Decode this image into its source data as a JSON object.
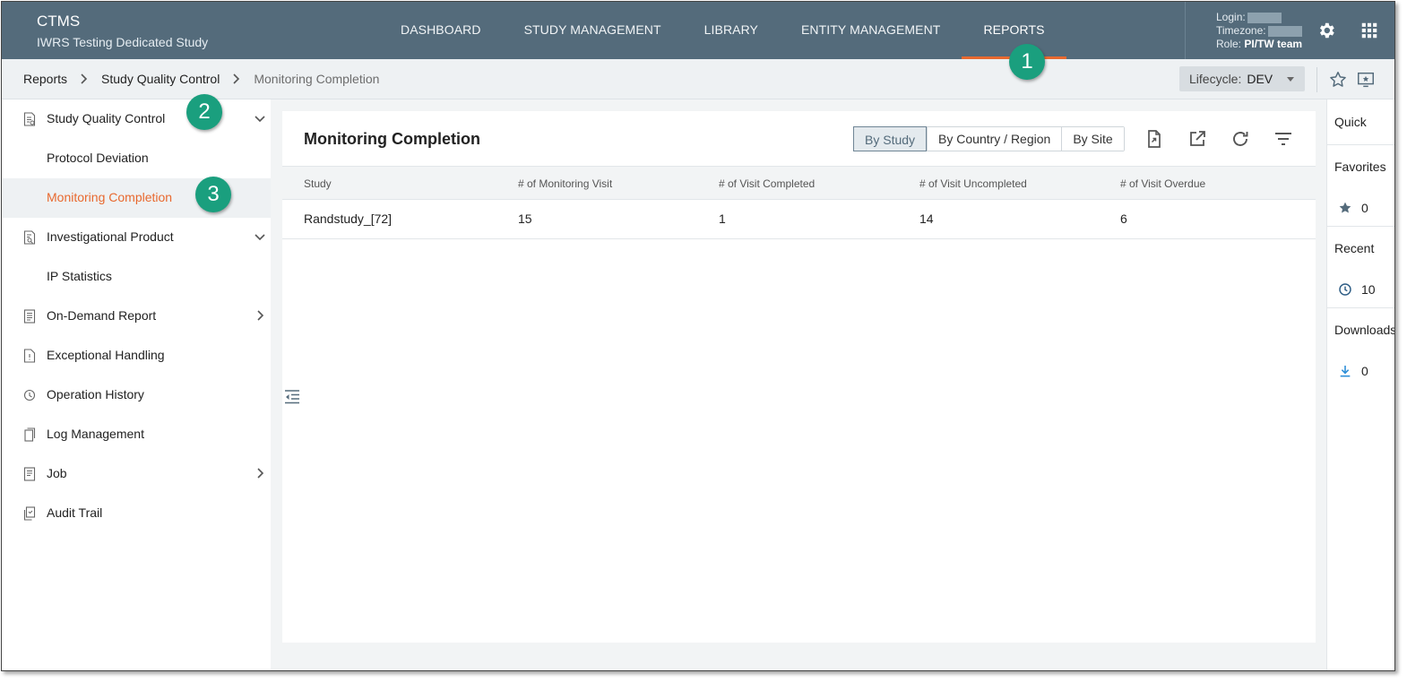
{
  "header": {
    "app_name": "CTMS",
    "study_name": "IWRS Testing Dedicated Study",
    "nav": [
      {
        "label": "DASHBOARD"
      },
      {
        "label": "STUDY MANAGEMENT"
      },
      {
        "label": "LIBRARY"
      },
      {
        "label": "ENTITY MANAGEMENT"
      },
      {
        "label": "REPORTS",
        "active": true
      }
    ],
    "user": {
      "login_label": "Login:",
      "timezone_label": "Timezone:",
      "role_label": "Role:",
      "role_value": "PI/TW team"
    },
    "icons": [
      "gear-icon",
      "apps-grid-icon"
    ]
  },
  "breadcrumb": {
    "items": [
      "Reports",
      "Study Quality Control",
      "Monitoring Completion"
    ],
    "lifecycle_label": "Lifecycle:",
    "lifecycle_value": "DEV"
  },
  "sidebar": {
    "items": [
      {
        "label": "Study Quality Control",
        "icon": "report-check-icon",
        "chevron": "down"
      },
      {
        "label": "Protocol Deviation",
        "sub": true
      },
      {
        "label": "Monitoring Completion",
        "sub": true,
        "active": true
      },
      {
        "label": "Investigational Product",
        "icon": "report-search-icon",
        "chevron": "down"
      },
      {
        "label": "IP Statistics",
        "sub": true
      },
      {
        "label": "On-Demand Report",
        "icon": "report-list-icon",
        "chevron": "right"
      },
      {
        "label": "Exceptional Handling",
        "icon": "document-alert-icon"
      },
      {
        "label": "Operation History",
        "icon": "history-icon"
      },
      {
        "label": "Log Management",
        "icon": "log-copy-icon"
      },
      {
        "label": "Job",
        "icon": "job-list-icon",
        "chevron": "right"
      },
      {
        "label": "Audit Trail",
        "icon": "audit-doc-icon"
      }
    ]
  },
  "main": {
    "title": "Monitoring Completion",
    "view_toggle": [
      "By Study",
      "By Country / Region",
      "By Site"
    ],
    "active_view": "By Study",
    "table": {
      "columns": [
        "Study",
        "# of Monitoring Visit",
        "# of Visit Completed",
        "# of Visit Uncompleted",
        "# of Visit Overdue"
      ],
      "rows": [
        [
          "Randstudy_[72]",
          "15",
          "1",
          "14",
          "6"
        ]
      ]
    }
  },
  "quick_panel": {
    "quick_label": "Quick",
    "favorites_label": "Favorites",
    "favorites_count": "0",
    "recent_label": "Recent",
    "recent_count": "10",
    "downloads_label": "Downloads",
    "downloads_count": "0"
  },
  "callouts": [
    "1",
    "2",
    "3"
  ],
  "colors": {
    "header_bg": "#546b7b",
    "accent": "#e8692f",
    "callout": "#1a9f7e"
  }
}
